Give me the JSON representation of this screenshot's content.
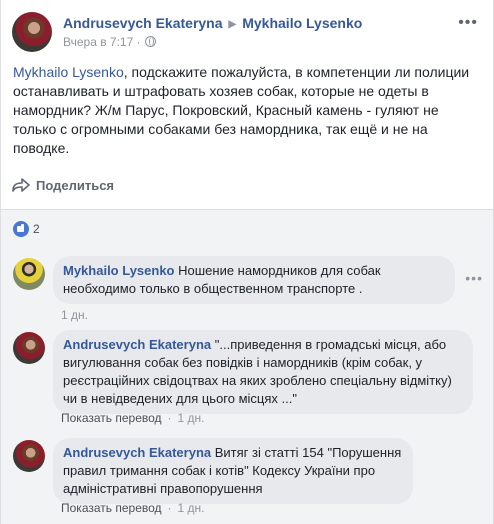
{
  "post": {
    "author": "Andrusevych Ekateryna",
    "target": "Mykhailo Lysenko",
    "timestamp": "Вчера в 7:17",
    "audience_icon": "globe-icon",
    "more_icon": "more-dots-icon",
    "mention": "Mykhailo Lysenko",
    "text": ", подскажите пожалуйста, в компетенции ли полиции останавливать и штрафовать хозяев собак, которые не одеты в намордник? Ж/м Парус, Покровский, Красный камень - гуляют не только с огромными собаками без намордника, так ещё и не на поводке."
  },
  "actions": {
    "share_label": "Поделиться",
    "share_icon": "share-arrow-icon"
  },
  "reactions": {
    "icon": "like-icon",
    "count": "2"
  },
  "comments": [
    {
      "author": "Mykhailo Lysenko",
      "text": "Ношение намордников для собак необходимо только в общественном транспорте .",
      "time": "1 дн.",
      "translate": ""
    },
    {
      "author": "Andrusevych Ekateryna",
      "text": "\"...приведення в громадські місця, або вигулювання собак без повідків і намордників (крім собак, у реєстраційних свідоцтвах на яких зроблено спеціальну відмітку) чи в невідведених для цього місцях ...\"",
      "time": "1 дн.",
      "translate": "Показать перевод"
    },
    {
      "author": "Andrusevych Ekateryna",
      "text": "Витяг зі статті 154 \"Порушення правил тримання собак і котів\" Кодексу України про адміністративні правопорушення",
      "time": "1 дн.",
      "translate": "Показать перевод"
    }
  ],
  "colors": {
    "link": "#365899",
    "meta": "#90949c",
    "bubble": "#e7e9ec",
    "comments_bg": "#f2f3f5"
  }
}
